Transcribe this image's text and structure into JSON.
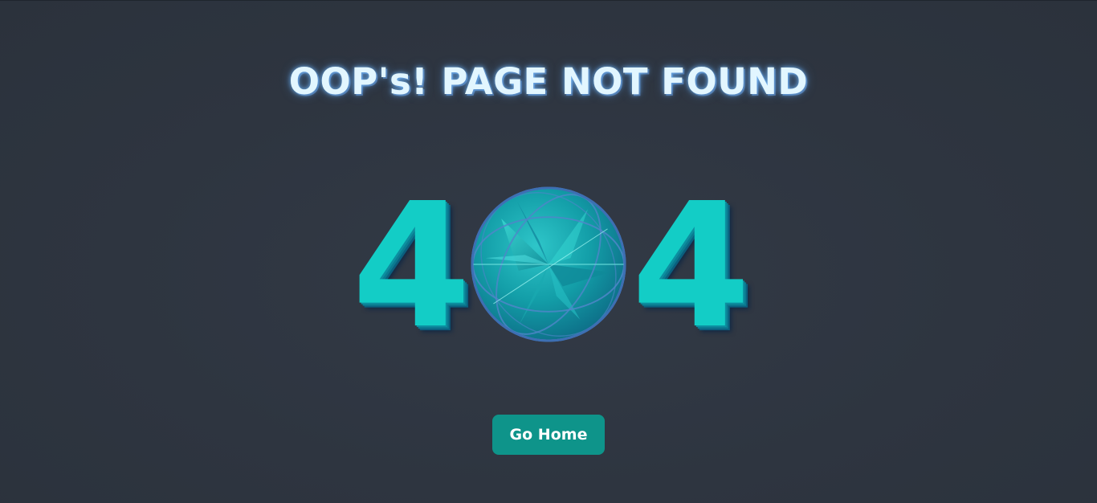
{
  "header": {
    "title": "OOP's! PAGE NOT FOUND"
  },
  "error": {
    "digit_left": "4",
    "globe_icon": "globe-icon",
    "digit_right": "4",
    "accent_color": "#13cdc6"
  },
  "actions": {
    "home_label": "Go Home",
    "button_color": "#0e948a"
  },
  "colors": {
    "background": "#2e3540",
    "title": "#e2f6ff"
  }
}
